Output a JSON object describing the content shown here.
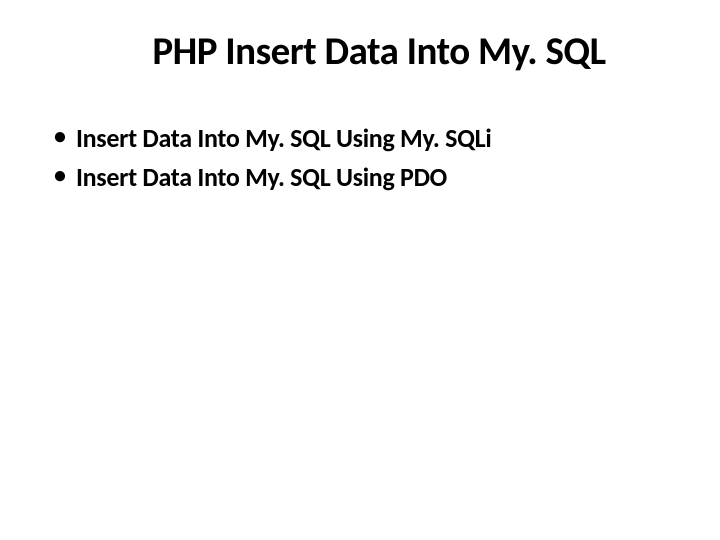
{
  "slide": {
    "title": "PHP Insert Data Into My. SQL",
    "bullets": [
      "Insert Data Into My. SQL Using My. SQLi",
      "Insert Data Into My. SQL Using PDO"
    ]
  }
}
